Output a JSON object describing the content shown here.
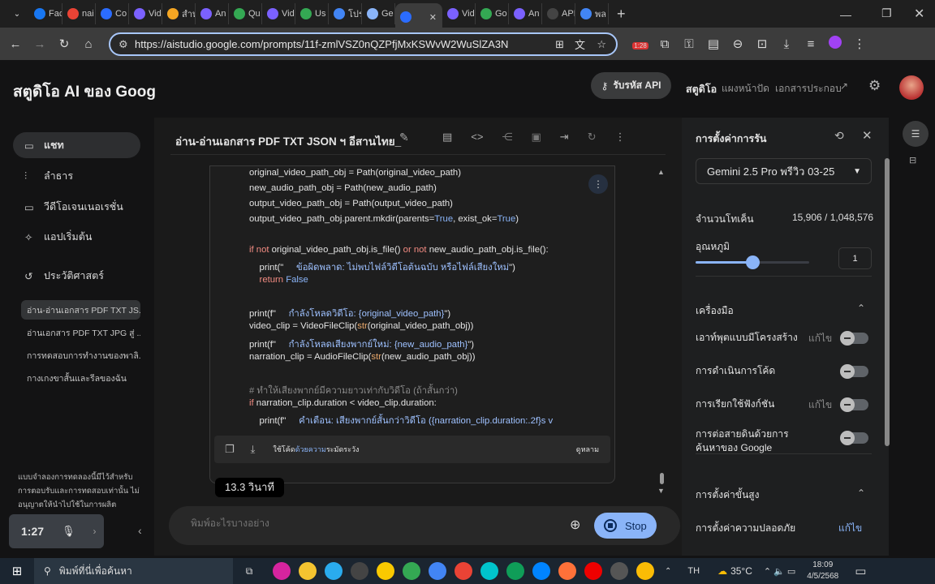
{
  "browser": {
    "tabs": [
      {
        "label": "Fac",
        "color": "#1877f2"
      },
      {
        "label": "nai",
        "color": "#ea4335"
      },
      {
        "label": "Co",
        "color": "#2b6cff"
      },
      {
        "label": "Vid",
        "color": "#7b61ff"
      },
      {
        "label": "สำห",
        "color": "#f5a623"
      },
      {
        "label": "An",
        "color": "#7b61ff"
      },
      {
        "label": "Qu",
        "color": "#34a853"
      },
      {
        "label": "Vid",
        "color": "#7b61ff"
      },
      {
        "label": "Us",
        "color": "#34a853"
      },
      {
        "label": "โปร",
        "color": "#4285f4"
      },
      {
        "label": "Ge",
        "color": "#8ab4f8"
      },
      {
        "label": "",
        "color": "#2b6cff",
        "active": true
      },
      {
        "label": "Vid",
        "color": "#7b61ff"
      },
      {
        "label": "Go",
        "color": "#34a853"
      },
      {
        "label": "An",
        "color": "#7b61ff"
      },
      {
        "label": "API",
        "color": "#444444"
      },
      {
        "label": "พล",
        "color": "#4285f4"
      }
    ],
    "url": "https://aistudio.google.com/prompts/11f-zmlVSZ0nQZPfjMxKSWvW2WuSlZA3N",
    "extension_badge": "1:28"
  },
  "header": {
    "title": "สตูดิโอ AI ของ Goog",
    "api_button": "รับรหัส API",
    "nav": [
      "สตูดิโอ",
      "แผงหน้าปัด",
      "เอกสารประกอบ"
    ]
  },
  "sidebar": {
    "items": [
      {
        "label": "แชท",
        "icon": "chat-icon",
        "active": true
      },
      {
        "label": "ลำธาร",
        "icon": "stream-icon"
      },
      {
        "label": "วีดีโอเจนเนอเรชั่น",
        "icon": "video-icon"
      },
      {
        "label": "แอปเริ่มต้น",
        "icon": "app-icon"
      },
      {
        "label": "ประวัติศาสตร์",
        "icon": "history-icon"
      }
    ],
    "history": [
      "อ่าน-อ่านเอกสาร PDF TXT JS...",
      "อ่านเอกสาร PDF TXT JPG สู่ ...",
      "การทดสอบการทำงานของพาลิ...",
      "กางเกงขาสั้นและรีลของฉัน"
    ],
    "disclaimer": "แบบจำลองการทดลองนี้มีไว้สำหรับการตอบรับและการทดสอบเท่านั้น ไม่อนุญาตให้นำไปใช้ในการผลิต"
  },
  "recorder": {
    "time": "1:27"
  },
  "chat": {
    "title": "อ่าน-อ่านเอกสาร PDF TXT JSON ฯ อีสานไทย_",
    "code_lines": [
      [
        {
          "t": "original_video_path_obj = Path(original_video_path)"
        }
      ],
      [
        {
          "t": "new_audio_path_obj = Path(new_audio_path)"
        }
      ],
      [
        {
          "t": "output_video_path_obj = Path(output_video_path)"
        }
      ],
      [
        {
          "t": "output_video_path_obj.parent.mkdir(parents="
        },
        {
          "t": "True",
          "c": "bl"
        },
        {
          "t": ", exist_ok="
        },
        {
          "t": "True",
          "c": "bl"
        },
        {
          "t": ")"
        }
      ],
      [],
      [
        {
          "t": "if not",
          "c": "kw"
        },
        {
          "t": " original_video_path_obj.is_file() "
        },
        {
          "t": "or not",
          "c": "kw"
        },
        {
          "t": " new_audio_path_obj.is_file():"
        }
      ],
      [
        {
          "t": "    print(\"     "
        },
        {
          "t": "ข้อผิดพลาด: ไม่พบไฟล์วิดีโอต้นฉบับ หรือไฟล์เสียงใหม่",
          "c": "th"
        },
        {
          "t": "\")"
        }
      ],
      [
        {
          "t": "    return",
          "c": "kw"
        },
        {
          "t": " False",
          "c": "bl"
        }
      ],
      [],
      [
        {
          "t": "print(f\"     "
        },
        {
          "t": "กำลังโหลดวิดีโอ: {original_video_path}",
          "c": "th"
        },
        {
          "t": "\")"
        }
      ],
      [
        {
          "t": "video_clip = VideoFileClip("
        },
        {
          "t": "str",
          "c": "fn"
        },
        {
          "t": "(original_video_path_obj))"
        }
      ],
      [
        {
          "t": "print(f\"     "
        },
        {
          "t": "กำลังโหลดเสียงพากย์ใหม่: {new_audio_path}",
          "c": "th"
        },
        {
          "t": "\")"
        }
      ],
      [
        {
          "t": "narration_clip = AudioFileClip("
        },
        {
          "t": "str",
          "c": "fn"
        },
        {
          "t": "(new_audio_path_obj))"
        }
      ],
      [],
      [
        {
          "t": "# ทำให้เสียงพากย์มีความยาวเท่ากับวิดีโอ (ถ้าสั้นกว่า)",
          "c": "cm"
        }
      ],
      [
        {
          "t": "if",
          "c": "kw"
        },
        {
          "t": " narration_clip.duration < video_clip.duration:"
        }
      ],
      [
        {
          "t": "    print(f\"     "
        },
        {
          "t": "คำเตือน: เสียงพากย์สั้นกว่าวิดีโอ ({narration_clip.duration:.2f}s v",
          "c": "th"
        }
      ]
    ],
    "code_footer_a": "ใช้โค้ด",
    "code_footer_b": "ด้วยความ",
    "code_footer_c": "ระมัดระวัง",
    "code_footer_right": "ดูหลาม",
    "elapsed": "13.3 วินาที",
    "input_placeholder": "พิมพ์อะไรบางอย่าง",
    "stop_label": "Stop"
  },
  "settings": {
    "title": "การตั้งค่าการรัน",
    "model": "Gemini 2.5 Pro พรีวิว 03-25",
    "token_label": "จำนวนโทเค็น",
    "token_value": "15,906 / 1,048,576",
    "temperature_label": "อุณหภูมิ",
    "temperature": 1,
    "temperature_max": 2,
    "tools_label": "เครื่องมือ",
    "tools": [
      {
        "label": "เอาท์พุตแบบมีโครงสร้าง",
        "edit": "แก้ไข",
        "on": false
      },
      {
        "label": "การดำเนินการโค้ด",
        "on": false
      },
      {
        "label": "การเรียกใช้ฟังก์ชัน",
        "edit": "แก้ไข",
        "on": false
      },
      {
        "label": "การต่อสายดินด้วยการค้นหาของ Google",
        "on": false
      }
    ],
    "advanced_label": "การตั้งค่าขั้นสูง",
    "safety_label": "การตั้งค่าความปลอดภัย",
    "safety_edit": "แก้ไข"
  },
  "taskbar": {
    "search": "พิมพ์ที่นี่เพื่อค้นหา",
    "lang": "TH",
    "weather": "35°C",
    "time": "18:09",
    "date": "4/5/2568",
    "icons": [
      "instagram",
      "explorer",
      "telegram",
      "player",
      "notes",
      "chrome",
      "chrome",
      "chrome",
      "canva",
      "edge",
      "messenger",
      "firefox",
      "record",
      "calculator",
      "chrome"
    ],
    "colors": [
      "#d6249f",
      "#f4c430",
      "#2aabee",
      "#444",
      "#f9c900",
      "#34a853",
      "#4285f4",
      "#ea4335",
      "#00c4cc",
      "#0f9d58",
      "#0084ff",
      "#ff7139",
      "#e00",
      "#555",
      "#fbbc05"
    ]
  }
}
